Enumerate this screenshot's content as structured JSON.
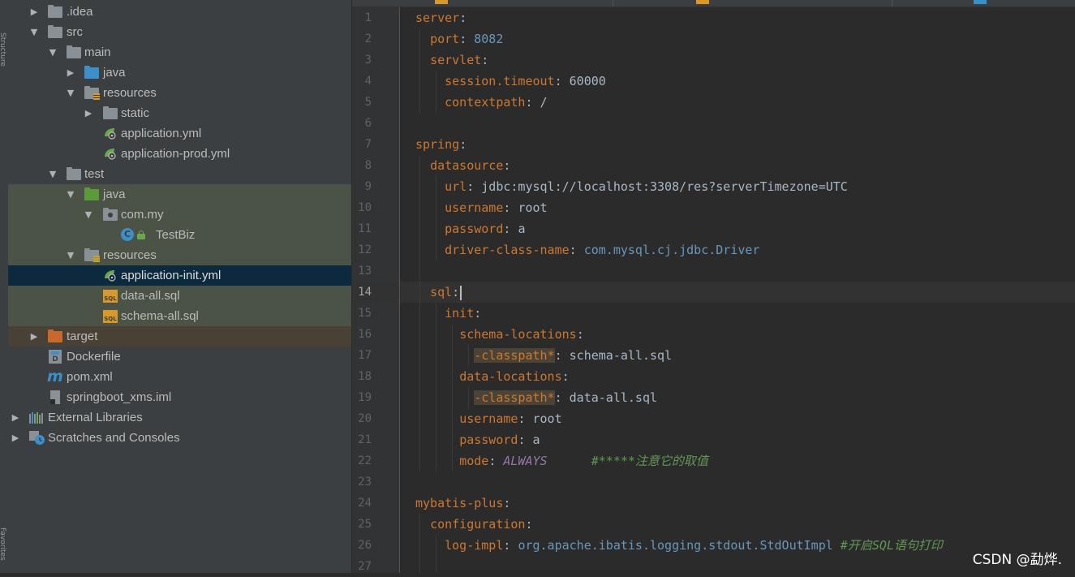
{
  "side_strip": {
    "top_label": "Structure",
    "bottom_label": "Favorites"
  },
  "tree": {
    "items": [
      {
        "label": ".idea"
      },
      {
        "label": "src"
      },
      {
        "label": "main"
      },
      {
        "label": "java"
      },
      {
        "label": "resources"
      },
      {
        "label": "static"
      },
      {
        "label": "application.yml"
      },
      {
        "label": "application-prod.yml"
      },
      {
        "label": "test"
      },
      {
        "label": "java"
      },
      {
        "label": "com.my"
      },
      {
        "label": "TestBiz"
      },
      {
        "label": "resources"
      },
      {
        "label": "application-init.yml"
      },
      {
        "label": "data-all.sql"
      },
      {
        "label": "schema-all.sql"
      },
      {
        "label": "target"
      },
      {
        "label": "Dockerfile"
      },
      {
        "label": "pom.xml"
      },
      {
        "label": "springboot_xms.iml"
      },
      {
        "label": "External Libraries"
      },
      {
        "label": "Scratches and Consoles"
      }
    ],
    "sql_badge": "SQL",
    "class_badge": "C",
    "maven_badge": "m",
    "docker_badge": "D",
    "colors": {
      "selected": "#0d293e",
      "test_bg": "#4b5246",
      "excluded_bg": "#4a4136"
    }
  },
  "editor": {
    "current_line": 14,
    "lines": [
      {
        "n": "1"
      },
      {
        "n": "2"
      },
      {
        "n": "3"
      },
      {
        "n": "4"
      },
      {
        "n": "5"
      },
      {
        "n": "6"
      },
      {
        "n": "7"
      },
      {
        "n": "8"
      },
      {
        "n": "9"
      },
      {
        "n": "10"
      },
      {
        "n": "11"
      },
      {
        "n": "12"
      },
      {
        "n": "13"
      },
      {
        "n": "14"
      },
      {
        "n": "15"
      },
      {
        "n": "16"
      },
      {
        "n": "17"
      },
      {
        "n": "18"
      },
      {
        "n": "19"
      },
      {
        "n": "20"
      },
      {
        "n": "21"
      },
      {
        "n": "22"
      },
      {
        "n": "23"
      },
      {
        "n": "24"
      },
      {
        "n": "25"
      },
      {
        "n": "26"
      },
      {
        "n": "27"
      }
    ],
    "code": {
      "l1_key": "server",
      "l2_key": "port",
      "l2_val": "8082",
      "l3_key": "servlet",
      "l4_key": "session.timeout",
      "l4_val": "60000",
      "l5_key": "contextpath",
      "l5_val": "/",
      "l7_key": "spring",
      "l8_key": "datasource",
      "l9_key": "url",
      "l9_val": "jdbc:mysql://localhost:3308/res?serverTimezone=UTC",
      "l10_key": "username",
      "l10_val": "root",
      "l11_key": "password",
      "l11_val": "a",
      "l12_key": "driver-class-name",
      "l12_val": "com.mysql.cj.jdbc.Driver",
      "l14_key": "sql",
      "l15_key": "init",
      "l16_key": "schema-locations",
      "l17_key": "-classpath*",
      "l17_val": "schema-all.sql",
      "l18_key": "data-locations",
      "l19_key": "-classpath*",
      "l19_val": "data-all.sql",
      "l20_key": "username",
      "l20_val": "root",
      "l21_key": "password",
      "l21_val": "a",
      "l22_key": "mode",
      "l22_val": "ALWAYS",
      "l22_comment": "#*****注意它的取值",
      "l24_key": "mybatis-plus",
      "l25_key": "configuration",
      "l26_key": "log-impl",
      "l26_val": "org.apache.ibatis.logging.stdout.StdOutImpl",
      "l26_comment": "#开启SQL语句打印"
    },
    "colors": {
      "key": "#cc7832",
      "number": "#6897bb",
      "enum": "#9876aa",
      "comment": "#629755",
      "text": "#a9b7c6"
    }
  },
  "watermark": "CSDN @勐烨."
}
